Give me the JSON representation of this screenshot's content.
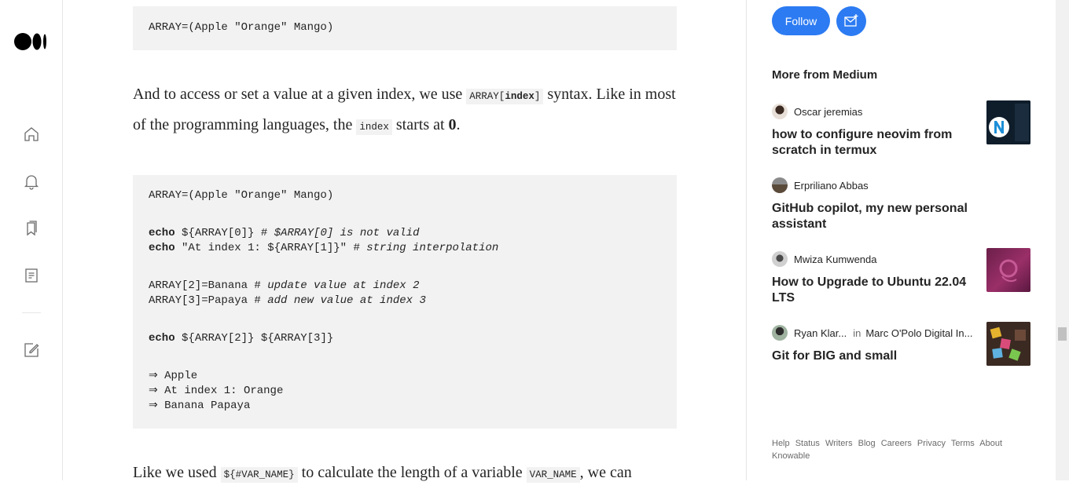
{
  "nav": {
    "icons": [
      "medium-logo",
      "home-icon",
      "notifications-icon",
      "bookmarks-icon",
      "stories-icon",
      "write-icon"
    ]
  },
  "article": {
    "code1": {
      "line1": "ARRAY=(Apple \"Orange\" Mango)"
    },
    "para1": {
      "t1": "And to access or set a value at a given index, we use ",
      "code_a": "ARRAY[",
      "code_b": "index",
      "code_c": "]",
      "t2": " syntax. Like in most of the programming languages, the ",
      "code2": "index",
      "t3": " starts at ",
      "zero": "0",
      "t4": "."
    },
    "code2": {
      "l1": "ARRAY=(Apple \"Orange\" Mango)",
      "l2_kw": "echo",
      "l2_rest": " ${ARRAY[0]} # ",
      "l2_cm": "$ARRAY[0] is not valid",
      "l3_kw": "echo",
      "l3_rest": " \"At index 1: ${ARRAY[1]}\" # ",
      "l3_cm": "string interpolation",
      "l4_code": "ARRAY[2]=Banana # ",
      "l4_cm": "update value at index 2",
      "l5_code": "ARRAY[3]=Papaya # ",
      "l5_cm": "add new value at index 3",
      "l6_kw": "echo",
      "l6_rest": " ${ARRAY[2]} ${ARRAY[3]}",
      "o1": "⇒ Apple",
      "o2": "⇒ At index 1: Orange",
      "o3": "⇒ Banana Papaya"
    },
    "para2": {
      "t1": "Like we used ",
      "code1": "${#VAR_NAME}",
      "t2": " to calculate the length of a variable ",
      "code2": "VAR_NAME",
      "t3": ", we can"
    }
  },
  "sidebar": {
    "follow_label": "Follow",
    "more_title": "More from Medium",
    "recs": [
      {
        "author": "Oscar jeremias",
        "title": "how to configure neovim from scratch in termux"
      },
      {
        "author": "Erpriliano Abbas",
        "title": "GitHub copilot, my new personal assistant"
      },
      {
        "author": "Mwiza Kumwenda",
        "title": "How to Upgrade to Ubuntu 22.04 LTS"
      },
      {
        "author": "Ryan Klar...",
        "in": "in",
        "publication": "Marc O'Polo Digital In...",
        "title": "Git for BIG and small"
      }
    ],
    "footer": [
      "Help",
      "Status",
      "Writers",
      "Blog",
      "Careers",
      "Privacy",
      "Terms",
      "About",
      "Knowable"
    ]
  },
  "colors": {
    "accent": "#2c7bf2",
    "code_bg": "#f2f2f2",
    "text": "#242424",
    "muted": "#6b6b6b"
  }
}
